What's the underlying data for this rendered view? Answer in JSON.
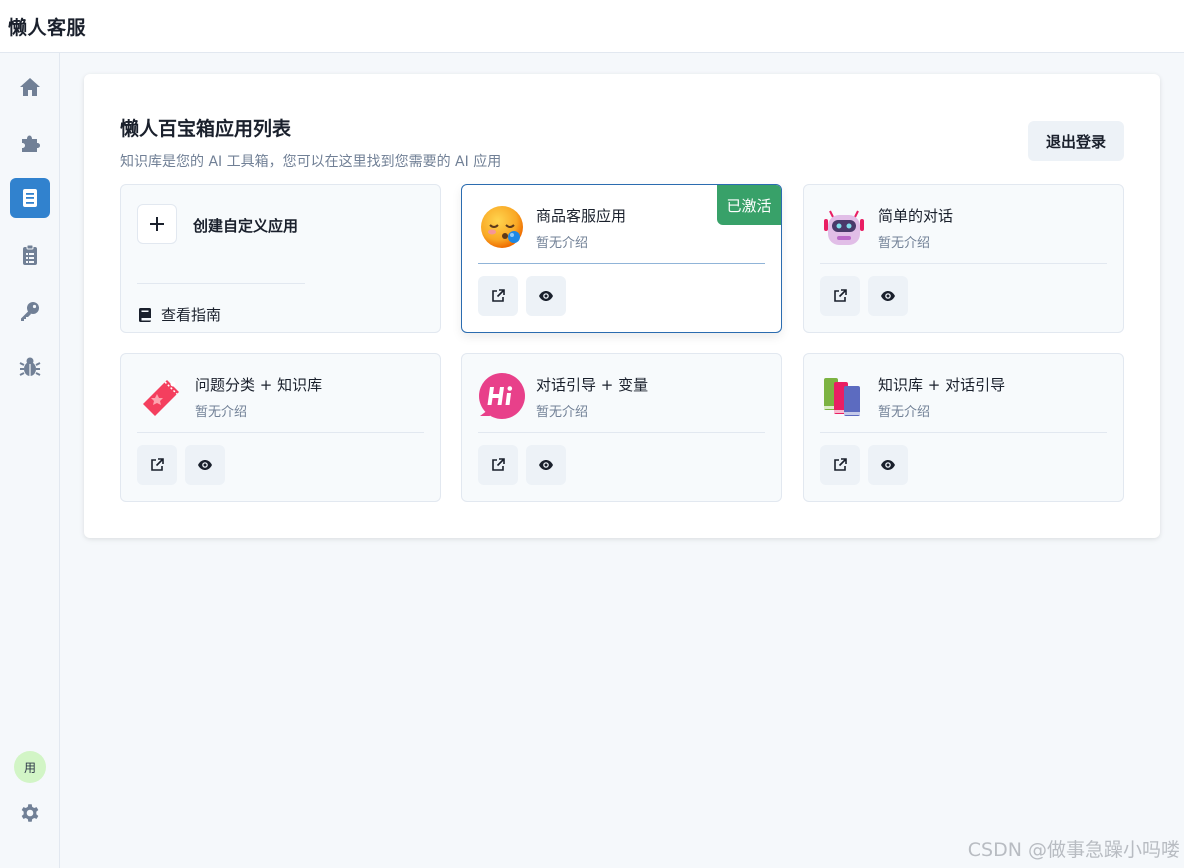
{
  "app": {
    "brand": "懒人客服"
  },
  "sidebar": {
    "items": [
      {
        "icon": "home-icon"
      },
      {
        "icon": "puzzle-icon"
      },
      {
        "icon": "book-icon",
        "active": true
      },
      {
        "icon": "clipboard-icon"
      },
      {
        "icon": "key-icon"
      },
      {
        "icon": "bug-icon"
      }
    ],
    "avatar_text": "用",
    "settings_icon": "gear-icon",
    "active_color": "#3182ce",
    "icon_color": "#718096"
  },
  "main": {
    "title": "懒人百宝箱应用列表",
    "subtitle": "知识库是您的 AI 工具箱，您可以在这里找到您需要的 AI 应用",
    "logout_label": "退出登录",
    "create_card": {
      "label": "创建自定义应用",
      "guide_label": "查看指南"
    },
    "apps": [
      {
        "name": "商品客服应用",
        "desc": "暂无介绍",
        "icon": "sleepy-face-icon",
        "badge": "已激活",
        "active": true
      },
      {
        "name": "简单的对话",
        "desc": "暂无介绍",
        "icon": "robot-icon"
      },
      {
        "name": "问题分类 + 知识库",
        "desc": "暂无介绍",
        "icon": "ticket-icon"
      },
      {
        "name": "对话引导 + 变量",
        "desc": "暂无介绍",
        "icon": "hi-bubble-icon"
      },
      {
        "name": "知识库 + 对话引导",
        "desc": "暂无介绍",
        "icon": "books-icon"
      }
    ],
    "badge_color": "#38a169"
  },
  "watermark": "CSDN @做事急躁小吗喽"
}
